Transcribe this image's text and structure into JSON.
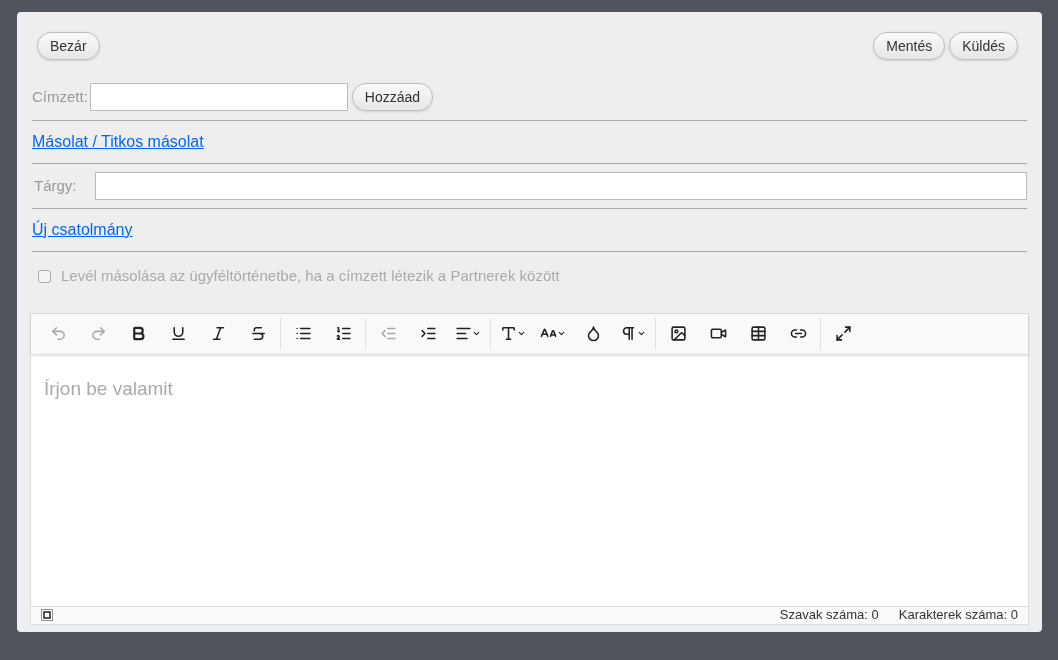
{
  "header": {
    "close_button": "Bezár",
    "save_button": "Mentés",
    "send_button": "Küldés"
  },
  "recipient": {
    "label": "Címzett:",
    "add_button": "Hozzáad"
  },
  "cc_link": "Másolat / Titkos másolat",
  "subject": {
    "label": "Tárgy:"
  },
  "attachment_link": "Új csatolmány",
  "copy_option": {
    "label": "Levél másolása az ügyféltörténetbe, ha a címzett létezik a Partnerek között",
    "checked": false
  },
  "toolbar": [
    [
      {
        "kind": "undo",
        "disabled": true,
        "dropdown": false
      },
      {
        "kind": "redo",
        "disabled": true,
        "dropdown": false
      },
      {
        "kind": "bold",
        "disabled": false,
        "dropdown": false
      },
      {
        "kind": "underline",
        "disabled": false,
        "dropdown": false
      },
      {
        "kind": "italic",
        "disabled": false,
        "dropdown": false
      },
      {
        "kind": "strike",
        "disabled": false,
        "dropdown": false
      }
    ],
    [
      {
        "kind": "bullets",
        "disabled": false,
        "dropdown": false
      },
      {
        "kind": "numbers",
        "disabled": false,
        "dropdown": false
      }
    ],
    [
      {
        "kind": "outdent",
        "disabled": true,
        "dropdown": false
      },
      {
        "kind": "indent",
        "disabled": false,
        "dropdown": false
      },
      {
        "kind": "align",
        "disabled": false,
        "dropdown": true
      }
    ],
    [
      {
        "kind": "font",
        "disabled": false,
        "dropdown": true
      },
      {
        "kind": "size",
        "disabled": false,
        "dropdown": true
      },
      {
        "kind": "color",
        "disabled": false,
        "dropdown": false
      },
      {
        "kind": "paragraph",
        "disabled": false,
        "dropdown": true
      }
    ],
    [
      {
        "kind": "image",
        "disabled": false,
        "dropdown": false
      },
      {
        "kind": "video",
        "disabled": false,
        "dropdown": false
      },
      {
        "kind": "table",
        "disabled": false,
        "dropdown": false
      },
      {
        "kind": "link",
        "disabled": false,
        "dropdown": false
      }
    ],
    [
      {
        "kind": "fullscreen",
        "disabled": false,
        "dropdown": false
      }
    ]
  ],
  "editor": {
    "placeholder": "Írjon be valamit"
  },
  "status": {
    "words": "Szavak száma: 0",
    "chars": "Karakterek száma: 0"
  }
}
